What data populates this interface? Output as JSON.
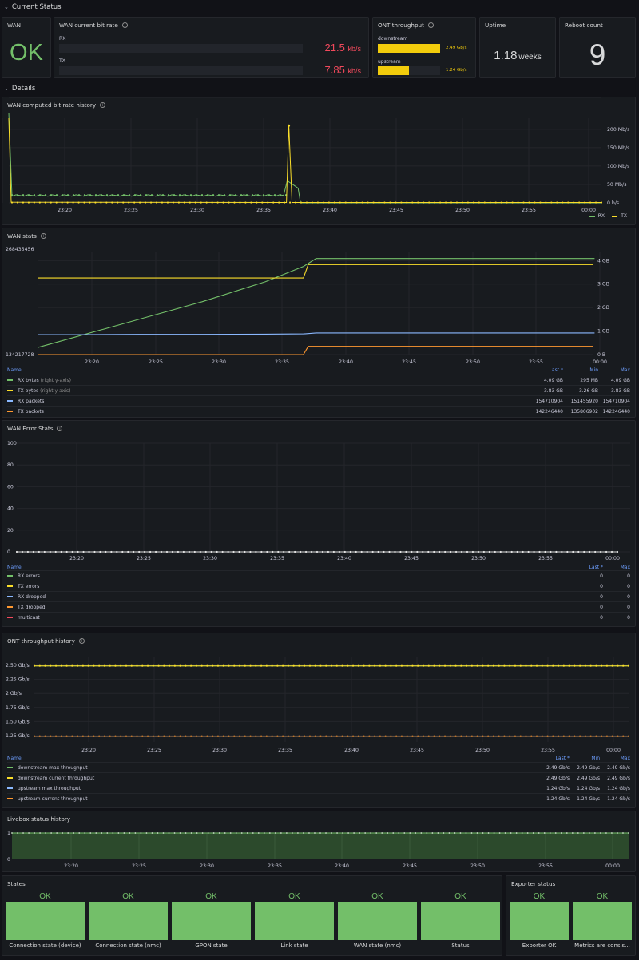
{
  "rows": {
    "current_status": "Current Status",
    "details": "Details"
  },
  "wan": {
    "title": "WAN",
    "value": "OK"
  },
  "bitrate": {
    "title": "WAN current bit rate",
    "rx_label": "RX",
    "rx_value": "21.5",
    "rx_unit": "kb/s",
    "tx_label": "TX",
    "tx_value": "7.85",
    "tx_unit": "kb/s"
  },
  "ont_now": {
    "title": "ONT throughput",
    "down_label": "downstream",
    "down_value": "2.49 Gb/s",
    "down_fraction": 1.0,
    "up_label": "upstream",
    "up_value": "1.24 Gb/s",
    "up_fraction": 0.5
  },
  "uptime": {
    "title": "Uptime",
    "value": "1.18",
    "unit": "weeks"
  },
  "reboot": {
    "title": "Reboot count",
    "value": "9"
  },
  "time_ticks": [
    "23:20",
    "23:25",
    "23:30",
    "23:35",
    "23:40",
    "23:45",
    "23:50",
    "23:55",
    "00:00"
  ],
  "colors": {
    "green": "#73bf69",
    "yellow": "#fade2a",
    "blue": "#8ab8ff",
    "orange": "#ff9830",
    "red": "#f2495c",
    "ok_green": "#73bf69",
    "bitrate_red": "#f2495c"
  },
  "bitrate_history": {
    "title": "WAN computed bit rate history",
    "yticks": [
      "200 Mb/s",
      "150 Mb/s",
      "100 Mb/s",
      "50 Mb/s",
      "0 b/s"
    ],
    "legend": [
      "RX",
      "TX"
    ]
  },
  "wan_stats": {
    "title": "WAN stats",
    "left_top": "268435456",
    "left_bottom": "134217728",
    "yticks": [
      "4 GB",
      "3 GB",
      "2 GB",
      "1 GB",
      "0 B"
    ],
    "columns": [
      "Name",
      "Last *",
      "Min",
      "Max"
    ],
    "rows": [
      {
        "name": "RX bytes",
        "suffix": "(right y-axis)",
        "last": "4.09 GB",
        "min": "295 MB",
        "max": "4.09 GB",
        "color": "#73bf69"
      },
      {
        "name": "TX bytes",
        "suffix": "(right y-axis)",
        "last": "3.83 GB",
        "min": "3.26 GB",
        "max": "3.83 GB",
        "color": "#fade2a"
      },
      {
        "name": "RX packets",
        "suffix": "",
        "last": "154710904",
        "min": "151455920",
        "max": "154710904",
        "color": "#8ab8ff"
      },
      {
        "name": "TX packets",
        "suffix": "",
        "last": "142246440",
        "min": "135806902",
        "max": "142246440",
        "color": "#ff9830"
      }
    ]
  },
  "wan_errors": {
    "title": "WAN Error Stats",
    "yticks": [
      "100",
      "80",
      "60",
      "40",
      "20",
      "0"
    ],
    "columns": [
      "Name",
      "Last *",
      "Max"
    ],
    "rows": [
      {
        "name": "RX errors",
        "last": "0",
        "max": "0",
        "color": "#73bf69"
      },
      {
        "name": "TX errors",
        "last": "0",
        "max": "0",
        "color": "#fade2a"
      },
      {
        "name": "RX dropped",
        "last": "0",
        "max": "0",
        "color": "#8ab8ff"
      },
      {
        "name": "TX dropped",
        "last": "0",
        "max": "0",
        "color": "#ff9830"
      },
      {
        "name": "multicast",
        "last": "0",
        "max": "0",
        "color": "#f2495c"
      }
    ]
  },
  "ont_history": {
    "title": "ONT throughput history",
    "yticks": [
      "2.50 Gb/s",
      "2.25 Gb/s",
      "2 Gb/s",
      "1.75 Gb/s",
      "1.50 Gb/s",
      "1.25 Gb/s"
    ],
    "columns": [
      "Name",
      "Last *",
      "Min",
      "Max"
    ],
    "rows": [
      {
        "name": "downstream max throughput",
        "last": "2.49 Gb/s",
        "min": "2.49 Gb/s",
        "max": "2.49 Gb/s",
        "color": "#73bf69"
      },
      {
        "name": "downstream current throughput",
        "last": "2.49 Gb/s",
        "min": "2.49 Gb/s",
        "max": "2.49 Gb/s",
        "color": "#fade2a"
      },
      {
        "name": "upstream max throughput",
        "last": "1.24 Gb/s",
        "min": "1.24 Gb/s",
        "max": "1.24 Gb/s",
        "color": "#8ab8ff"
      },
      {
        "name": "upstream current throughput",
        "last": "1.24 Gb/s",
        "min": "1.24 Gb/s",
        "max": "1.24 Gb/s",
        "color": "#ff9830"
      }
    ]
  },
  "livebox": {
    "title": "Livebox status history",
    "yticks": [
      "1",
      "0"
    ]
  },
  "states": {
    "title": "States",
    "tiles": [
      {
        "value": "OK",
        "label": "Connection state (device)"
      },
      {
        "value": "OK",
        "label": "Connection state (nmc)"
      },
      {
        "value": "OK",
        "label": "GPON state"
      },
      {
        "value": "OK",
        "label": "Link state"
      },
      {
        "value": "OK",
        "label": "WAN state (nmc)"
      },
      {
        "value": "OK",
        "label": "Status"
      }
    ]
  },
  "exporter": {
    "title": "Exporter status",
    "tiles": [
      {
        "value": "OK",
        "label": "Exporter OK"
      },
      {
        "value": "OK",
        "label": "Metrics are consis..."
      }
    ]
  },
  "chart_data": [
    {
      "type": "line",
      "title": "WAN computed bit rate history",
      "x": [
        "23:17",
        "23:20",
        "23:25",
        "23:30",
        "23:35",
        "23:38",
        "23:39",
        "23:40",
        "23:45",
        "23:50",
        "23:55",
        "00:00",
        "00:01"
      ],
      "ylim": [
        0,
        230
      ],
      "yunit": "Mb/s",
      "series": [
        {
          "name": "RX",
          "values": [
            245,
            22,
            21,
            22,
            21,
            22,
            70,
            0,
            0,
            0,
            0,
            0,
            0
          ]
        },
        {
          "name": "TX",
          "values": [
            2,
            1,
            1,
            1,
            1,
            1,
            210,
            1,
            1,
            1,
            1,
            1,
            1
          ]
        }
      ]
    },
    {
      "type": "line",
      "title": "WAN stats",
      "x": [
        "23:17",
        "23:20",
        "23:25",
        "23:30",
        "23:35",
        "23:38",
        "23:39",
        "23:45",
        "23:50",
        "23:55",
        "00:01"
      ],
      "series": [
        {
          "name": "RX bytes",
          "axis": "right",
          "unit": "GB",
          "values": [
            0.3,
            0.75,
            1.5,
            2.25,
            3.1,
            3.75,
            4.09,
            4.09,
            4.09,
            4.09,
            4.09
          ]
        },
        {
          "name": "TX bytes",
          "axis": "right",
          "unit": "GB",
          "values": [
            3.26,
            3.27,
            3.28,
            3.29,
            3.3,
            3.31,
            3.83,
            3.83,
            3.83,
            3.83,
            3.83
          ]
        },
        {
          "name": "RX packets",
          "axis": "right",
          "unit": "GB",
          "values": [
            0.85,
            0.85,
            0.86,
            0.86,
            0.87,
            0.88,
            0.92,
            0.92,
            0.92,
            0.92,
            0.92
          ]
        },
        {
          "name": "TX packets",
          "axis": "right",
          "unit": "GB",
          "values": [
            0.0,
            0.0,
            0.0,
            0.0,
            0.0,
            0.0,
            0.35,
            0.35,
            0.35,
            0.35,
            0.35
          ]
        }
      ]
    },
    {
      "type": "line",
      "title": "WAN Error Stats",
      "ylim": [
        0,
        100
      ],
      "series": [
        {
          "name": "RX errors",
          "values": [
            0,
            0
          ]
        },
        {
          "name": "TX errors",
          "values": [
            0,
            0
          ]
        },
        {
          "name": "RX dropped",
          "values": [
            0,
            0
          ]
        },
        {
          "name": "TX dropped",
          "values": [
            0,
            0
          ]
        },
        {
          "name": "multicast",
          "values": [
            0,
            0
          ]
        }
      ]
    },
    {
      "type": "line",
      "title": "ONT throughput history",
      "ylim": [
        1.2,
        2.55
      ],
      "yunit": "Gb/s",
      "series": [
        {
          "name": "downstream max throughput",
          "values": [
            2.49,
            2.49
          ]
        },
        {
          "name": "downstream current throughput",
          "values": [
            2.49,
            2.49
          ]
        },
        {
          "name": "upstream max throughput",
          "values": [
            1.24,
            1.24
          ]
        },
        {
          "name": "upstream current throughput",
          "values": [
            1.24,
            1.24
          ]
        }
      ]
    },
    {
      "type": "area",
      "title": "Livebox status history",
      "ylim": [
        0,
        1
      ],
      "series": [
        {
          "name": "status",
          "values": [
            1,
            1
          ]
        }
      ]
    }
  ]
}
